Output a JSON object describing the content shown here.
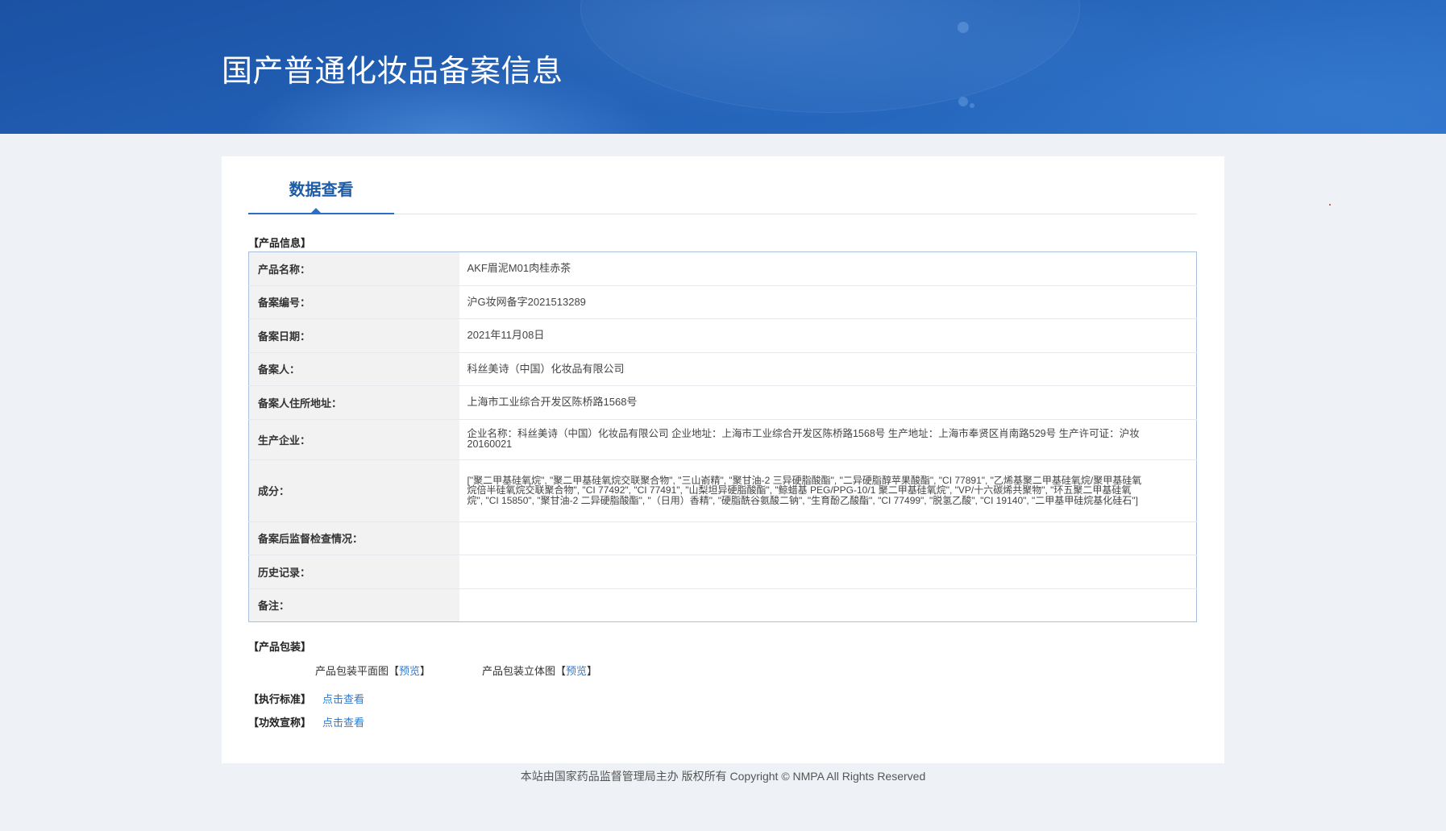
{
  "header": {
    "title": "国产普通化妆品备案信息"
  },
  "tabs": [
    {
      "label": "数据查看",
      "active": true
    }
  ],
  "product_info": {
    "section_title": "【产品信息】",
    "rows": [
      {
        "label": "产品名称：",
        "value": "AKF眉泥M01肉桂赤茶"
      },
      {
        "label": "备案编号：",
        "value": "沪G妆网备字2021513289"
      },
      {
        "label": "备案日期：",
        "value": "2021年11月08日"
      },
      {
        "label": "备案人：",
        "value": "科丝美诗（中国）化妆品有限公司"
      },
      {
        "label": "备案人住所地址：",
        "value": "上海市工业综合开发区陈桥路1568号"
      },
      {
        "label": "生产企业：",
        "value": "企业名称：科丝美诗（中国）化妆品有限公司 企业地址：上海市工业综合开发区陈桥路1568号 生产地址：上海市奉贤区肖南路529号 生产许可证：沪妆20160021"
      },
      {
        "label": "成分：",
        "value": "[\"聚二甲基硅氧烷\", \"聚二甲基硅氧烷交联聚合物\", \"三山嵛精\", \"聚甘油-2 三异硬脂酸酯\", \"二异硬脂醇苹果酸酯\", \"CI 77891\", \"乙烯基聚二甲基硅氧烷/聚甲基硅氧烷倍半硅氧烷交联聚合物\", \"CI 77492\", \"CI 77491\", \"山梨坦异硬脂酸酯\", \"鲸蜡基 PEG/PPG-10/1 聚二甲基硅氧烷\", \"VP/十六碳烯共聚物\", \"环五聚二甲基硅氧烷\", \"CI 15850\", \"聚甘油-2 二异硬脂酸酯\", \"（日用）香精\", \"硬脂酰谷氨酸二钠\", \"生育酚乙酸酯\", \"CI 77499\", \"脱氢乙酸\", \"CI 19140\", \"二甲基甲硅烷基化硅石\"]"
      },
      {
        "label": "备案后监督检查情况：",
        "value": ""
      },
      {
        "label": "历史记录：",
        "value": ""
      },
      {
        "label": "备注：",
        "value": ""
      }
    ]
  },
  "packaging": {
    "section_title": "【产品包装】",
    "items": [
      {
        "label": "产品包装平面图",
        "bracket_open": "【",
        "link": "预览",
        "bracket_close": "】"
      },
      {
        "label": "产品包装立体图",
        "bracket_open": "【",
        "link": "预览",
        "bracket_close": "】"
      }
    ]
  },
  "execution_standard": {
    "section_title": "【执行标准】",
    "link": "点击查看"
  },
  "efficacy_claim": {
    "section_title": "【功效宣称】",
    "link": "点击查看"
  },
  "footer": {
    "text": "本站由国家药品监督管理局主办 版权所有 Copyright © NMPA All Rights Reserved"
  },
  "colors": {
    "header_top": "#1b52a4",
    "header_bottom": "#2b71c8",
    "tab_active": "#1d5ba6",
    "tab_underline": "#2a6fc4",
    "link": "#2f7ad1",
    "table_border": "#a9c1dd",
    "label_background": "#f2f2f2",
    "page_background": "#eef2f6"
  }
}
